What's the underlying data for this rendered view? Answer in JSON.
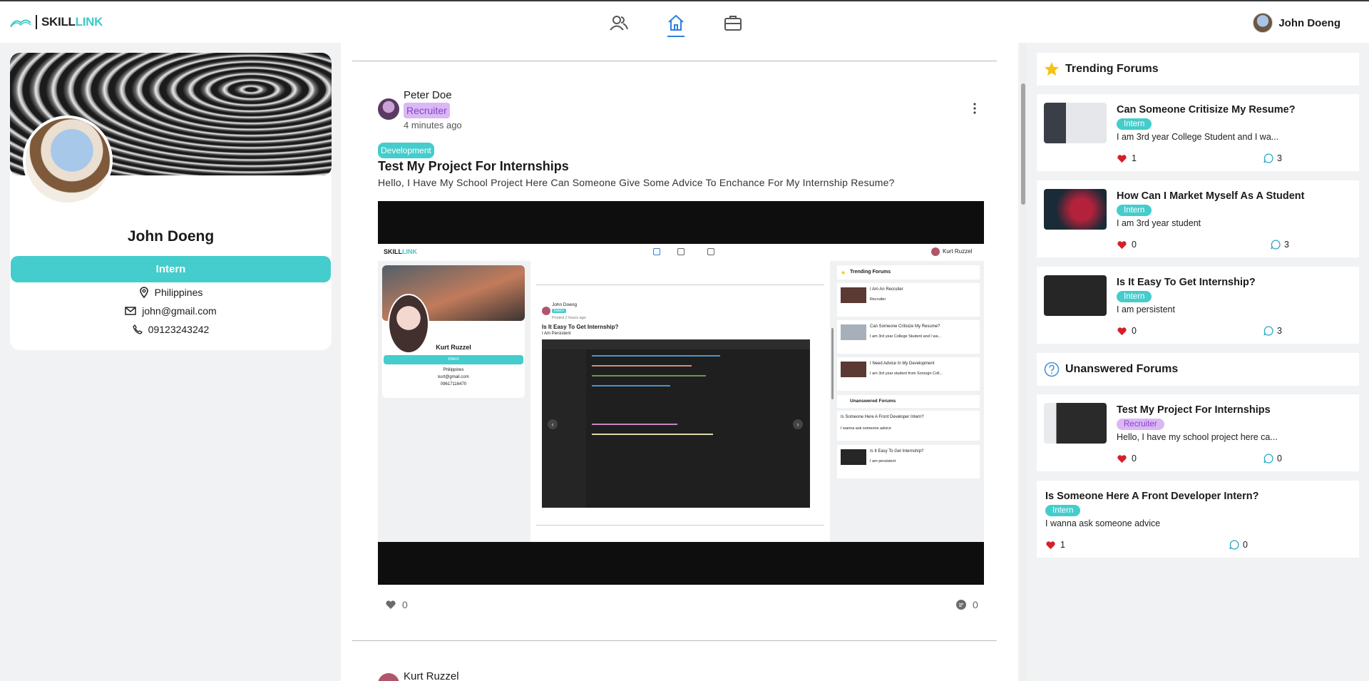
{
  "app": {
    "logo_text_1": "SKILL",
    "logo_text_2": "LINK"
  },
  "topbar": {
    "user_name": "John Doeng"
  },
  "profile": {
    "name": "John Doeng",
    "role": "Intern",
    "location": "Philippines",
    "email": "john@gmail.com",
    "phone": "09123243242"
  },
  "post": {
    "author": "Peter Doe",
    "author_role": "Recruiter",
    "time": "4 minutes ago",
    "tag": "Development",
    "title": "Test My Project For Internships",
    "body": "Hello, I Have My School Project Here Can Someone Give Some Advice To Enchance For My Internship Resume?",
    "likes": "0",
    "comments": "0"
  },
  "next_post": {
    "author": "Kurt Ruzzel"
  },
  "screenshot_in_post": {
    "user_name": "Kurt Ruzzel",
    "profile_role": "Intern",
    "profile_location": "Philippines",
    "profile_email": "kurt@gmail.com",
    "profile_phone": "09617116470",
    "post_author": "John Doeng",
    "post_role": "Intern",
    "post_time": "Posted 2 hours ago",
    "post_title": "Is It Easy To Get Internship?",
    "post_body": "I Am Persistent",
    "trending_title": "Trending Forums",
    "unanswered_title": "Unanswered Forums",
    "items": [
      {
        "title": "I Am An Recruiter",
        "desc": "Recruiter"
      },
      {
        "title": "Can Someone Critisize My Resume?",
        "desc": "I am 3rd year College Student and I wa..."
      },
      {
        "title": "I Need Advice In My Development",
        "desc": "I am 3rd year student from Sorsogn Coll..."
      },
      {
        "title": "Is Someone Here A Front Developer Intern?",
        "desc": "I wanna ask someone advice"
      },
      {
        "title": "Is It Easy To Get Internship?",
        "desc": "I am persistent"
      }
    ]
  },
  "trending": {
    "title": "Trending Forums",
    "items": [
      {
        "title": "Can Someone Critisize My Resume?",
        "role": "Intern",
        "desc": "I am 3rd year College Student and I wa...",
        "likes": "1",
        "comments": "3"
      },
      {
        "title": "How Can I Market Myself As A Student",
        "role": "Intern",
        "desc": "I am 3rd year student",
        "likes": "0",
        "comments": "3"
      },
      {
        "title": "Is It Easy To Get Internship?",
        "role": "Intern",
        "desc": "I am persistent",
        "likes": "0",
        "comments": "3"
      }
    ]
  },
  "unanswered": {
    "title": "Unanswered Forums",
    "items": [
      {
        "title": "Test My Project For Internships",
        "role": "Recruiter",
        "desc": "Hello, I have my school project here ca...",
        "likes": "0",
        "comments": "0"
      },
      {
        "title": "Is Someone Here A Front Developer Intern?",
        "role": "Intern",
        "desc": "I wanna ask someone advice",
        "likes": "1",
        "comments": "0"
      }
    ]
  },
  "colors": {
    "accent": "#45cccc",
    "recruiter_bg": "#d9b8f4",
    "recruiter_fg": "#8a3fc8",
    "heart": "#d61f2a",
    "nav_active": "#2f7fe0"
  }
}
